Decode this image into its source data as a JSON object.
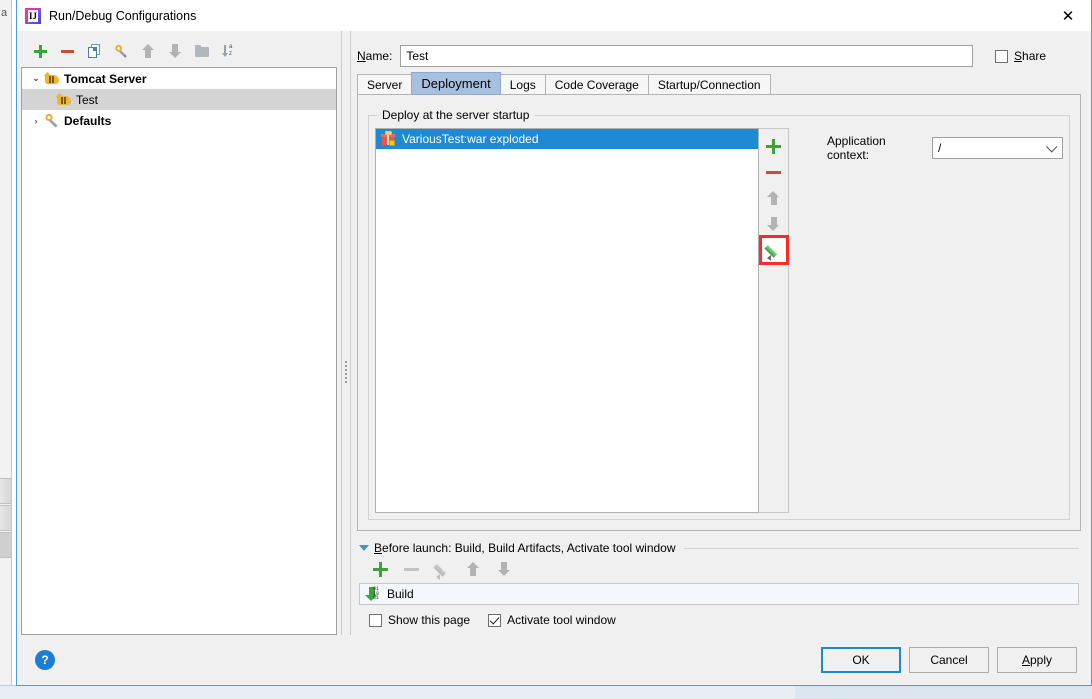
{
  "window": {
    "title": "Run/Debug Configurations",
    "title_icon": "intellij-idea-icon",
    "close_icon": "close-icon",
    "backdrop_label": "a"
  },
  "left_panel": {
    "toolbar": [
      {
        "name": "add-configuration-button",
        "icon": "plus-icon",
        "tooltip": "Add New Configuration"
      },
      {
        "name": "remove-configuration-button",
        "icon": "minus-icon",
        "tooltip": "Remove Configuration"
      },
      {
        "name": "copy-configuration-button",
        "icon": "copy-icon",
        "tooltip": "Copy Configuration"
      },
      {
        "name": "edit-defaults-button",
        "icon": "wrench-icon",
        "tooltip": "Edit defaults"
      },
      {
        "name": "move-up-button",
        "icon": "arrow-up-icon",
        "tooltip": "Move Up"
      },
      {
        "name": "move-down-button",
        "icon": "arrow-down-icon",
        "tooltip": "Move Down"
      },
      {
        "name": "create-folder-button",
        "icon": "folder-icon",
        "tooltip": "Create New Folder"
      },
      {
        "name": "sort-configurations-button",
        "icon": "sort-alpha-icon",
        "tooltip": "Sort Configurations"
      }
    ],
    "tree": [
      {
        "label": "Tomcat Server",
        "icon": "tomcat-icon",
        "arrow": "expanded",
        "bold": true,
        "selected": false,
        "level": 0
      },
      {
        "label": "Test",
        "icon": "tomcat-icon",
        "arrow": "none",
        "bold": false,
        "selected": true,
        "level": 1
      },
      {
        "label": "Defaults",
        "icon": "wrench-icon",
        "arrow": "collapsed",
        "bold": true,
        "selected": false,
        "level": 0
      }
    ]
  },
  "right_panel": {
    "name_label": "Name:",
    "name_label_mnemonic": "N",
    "name_value": "Test",
    "share": {
      "label": "Share",
      "mnemonic": "S",
      "checked": false
    },
    "tabs": [
      {
        "label": "Server",
        "active": false
      },
      {
        "label": "Deployment",
        "active": true
      },
      {
        "label": "Logs",
        "active": false
      },
      {
        "label": "Code Coverage",
        "active": false
      },
      {
        "label": "Startup/Connection",
        "active": false
      }
    ],
    "deployment": {
      "group_title": "Deploy at the server startup",
      "items": [
        {
          "label": "VariousTest:war exploded",
          "icon": "artifact-icon",
          "selected": true
        }
      ],
      "side_toolbar": [
        {
          "name": "add-artifact-button",
          "icon": "plus-icon",
          "enabled": true,
          "highlighted": false
        },
        {
          "name": "remove-artifact-button",
          "icon": "minus-icon",
          "enabled": true,
          "highlighted": false
        },
        {
          "name": "move-artifact-up-button",
          "icon": "arrow-up-icon",
          "enabled": false,
          "highlighted": false
        },
        {
          "name": "move-artifact-down-button",
          "icon": "arrow-down-icon",
          "enabled": false,
          "highlighted": false
        },
        {
          "name": "edit-artifact-button",
          "icon": "pencil-icon",
          "enabled": true,
          "highlighted": true
        }
      ],
      "application_context": {
        "label": "Application context:",
        "value": "/",
        "arrow_icon": "chevron-down-icon"
      }
    },
    "before_launch": {
      "header": "Before launch: Build, Build Artifacts, Activate tool window",
      "header_mnemonic": "B",
      "toolbar": [
        {
          "name": "add-task-button",
          "icon": "plus-icon",
          "enabled": true
        },
        {
          "name": "remove-task-button",
          "icon": "minus-icon",
          "enabled": false
        },
        {
          "name": "edit-task-button",
          "icon": "pencil-icon",
          "enabled": false
        },
        {
          "name": "move-task-up-button",
          "icon": "arrow-up-icon",
          "enabled": false
        },
        {
          "name": "move-task-down-button",
          "icon": "arrow-down-icon",
          "enabled": false
        }
      ],
      "tasks": [
        {
          "label": "Build",
          "icon": "build-icon"
        }
      ],
      "checkboxes": [
        {
          "name": "show-this-page-checkbox",
          "label": "Show this page",
          "checked": false
        },
        {
          "name": "activate-tool-window-checkbox",
          "label": "Activate tool window",
          "checked": true
        }
      ]
    }
  },
  "footer": {
    "help_icon": "help-icon",
    "help_label": "?",
    "buttons": [
      {
        "name": "ok-button",
        "label": "OK",
        "default": true
      },
      {
        "name": "cancel-button",
        "label": "Cancel",
        "default": false
      },
      {
        "name": "apply-button",
        "label": "Apply",
        "mnemonic": "A",
        "default": false
      }
    ]
  },
  "colors": {
    "accent": "#1f8ad2",
    "highlight_box": "#fb2b2b",
    "active_tab": "#a8c0e0",
    "dialog_bg": "#f0f0f0"
  }
}
